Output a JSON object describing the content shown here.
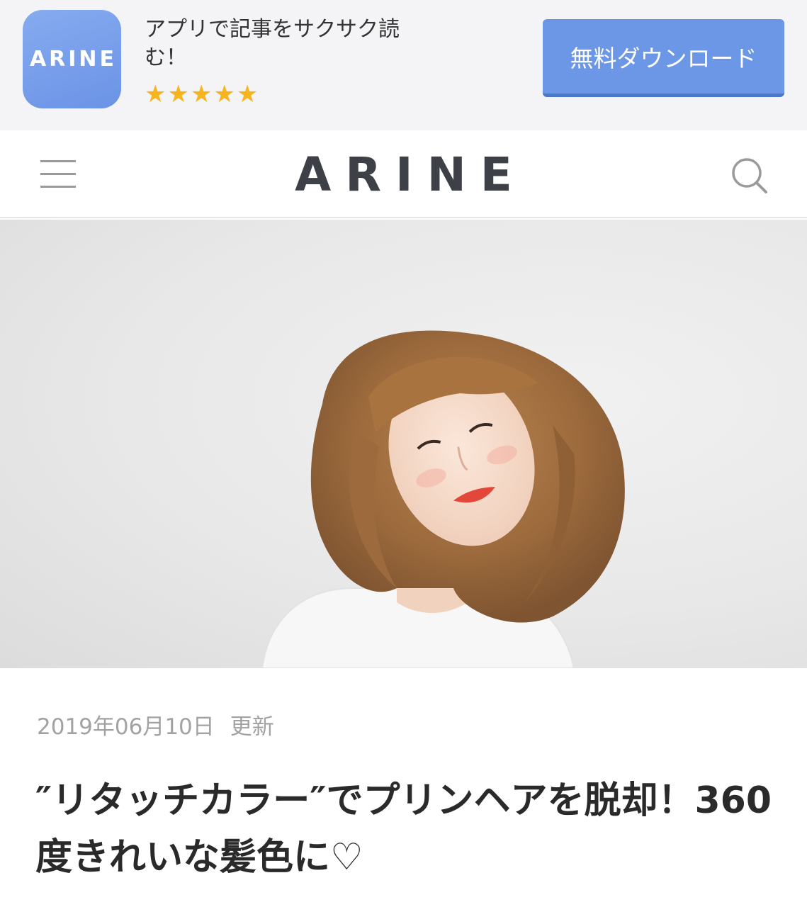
{
  "app_banner": {
    "icon_text": "ARINE",
    "tagline": "アプリで記事をサクサク読む！",
    "stars": "★★★★★",
    "rating": 5,
    "download_label": "無料ダウンロード",
    "accent_color": "#6b97e6"
  },
  "header": {
    "logo": "ARINE",
    "menu_icon": "hamburger-icon",
    "search_icon": "search-icon"
  },
  "hero": {
    "image": "woman-with-brown-bob-hair-photo"
  },
  "article": {
    "date": "2019年06月10日",
    "update_label": "更新",
    "title": "″リタッチカラー″でプリンヘアを脱却！360度きれいな髪色に♡"
  }
}
